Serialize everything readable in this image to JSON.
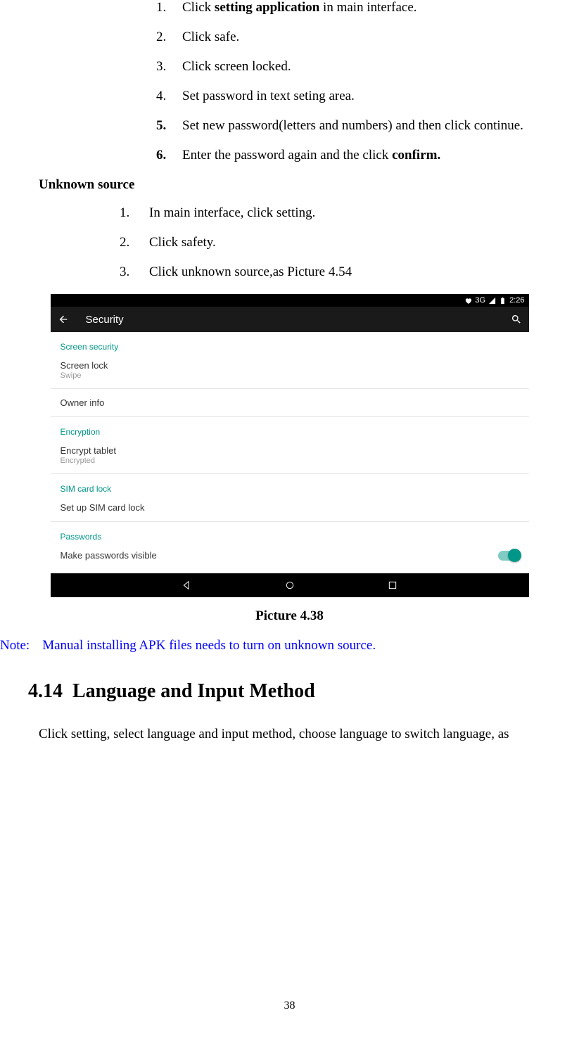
{
  "list1": [
    {
      "num": "1.",
      "pre": "Click ",
      "bold": "setting application",
      "post": " in main interface."
    },
    {
      "num": "2.",
      "pre": "Click safe."
    },
    {
      "num": "3.",
      "pre": "Click screen locked."
    },
    {
      "num": "4.",
      "pre": "Set password in text seting area."
    },
    {
      "num": "5.",
      "pre": "Set new password(letters and numbers) and then click continue."
    },
    {
      "num": "6.",
      "pre": "Enter the password again and the click ",
      "bold": "confirm."
    }
  ],
  "subheading": "Unknown source",
  "list2": [
    {
      "num": "1.",
      "txt": "In main interface, click setting."
    },
    {
      "num": "2.",
      "txt": "Click safety."
    },
    {
      "num": "3.",
      "txt": "Click unknown source,as Picture 4.54"
    }
  ],
  "screenshot": {
    "statusbar": {
      "net": "3G",
      "time": "2:26"
    },
    "appbar_title": "Security",
    "sections": {
      "screen_security": "Screen security",
      "screen_lock": "Screen lock",
      "screen_lock_sub": "Swipe",
      "owner_info": "Owner info",
      "encryption": "Encryption",
      "encrypt_tablet": "Encrypt tablet",
      "encrypt_tablet_sub": "Encrypted",
      "sim_lock": "SIM card lock",
      "setup_sim": "Set up SIM card lock",
      "passwords": "Passwords",
      "make_visible": "Make passwords visible"
    }
  },
  "caption": "Picture 4.38",
  "note_label": "Note:",
  "note_text": "Manual installing APK files needs to turn on unknown source.",
  "heading": {
    "num": "4.14",
    "title": "Language and Input Method"
  },
  "para": "Click setting, select language and input method, choose language to switch language, as",
  "page_num": "38"
}
